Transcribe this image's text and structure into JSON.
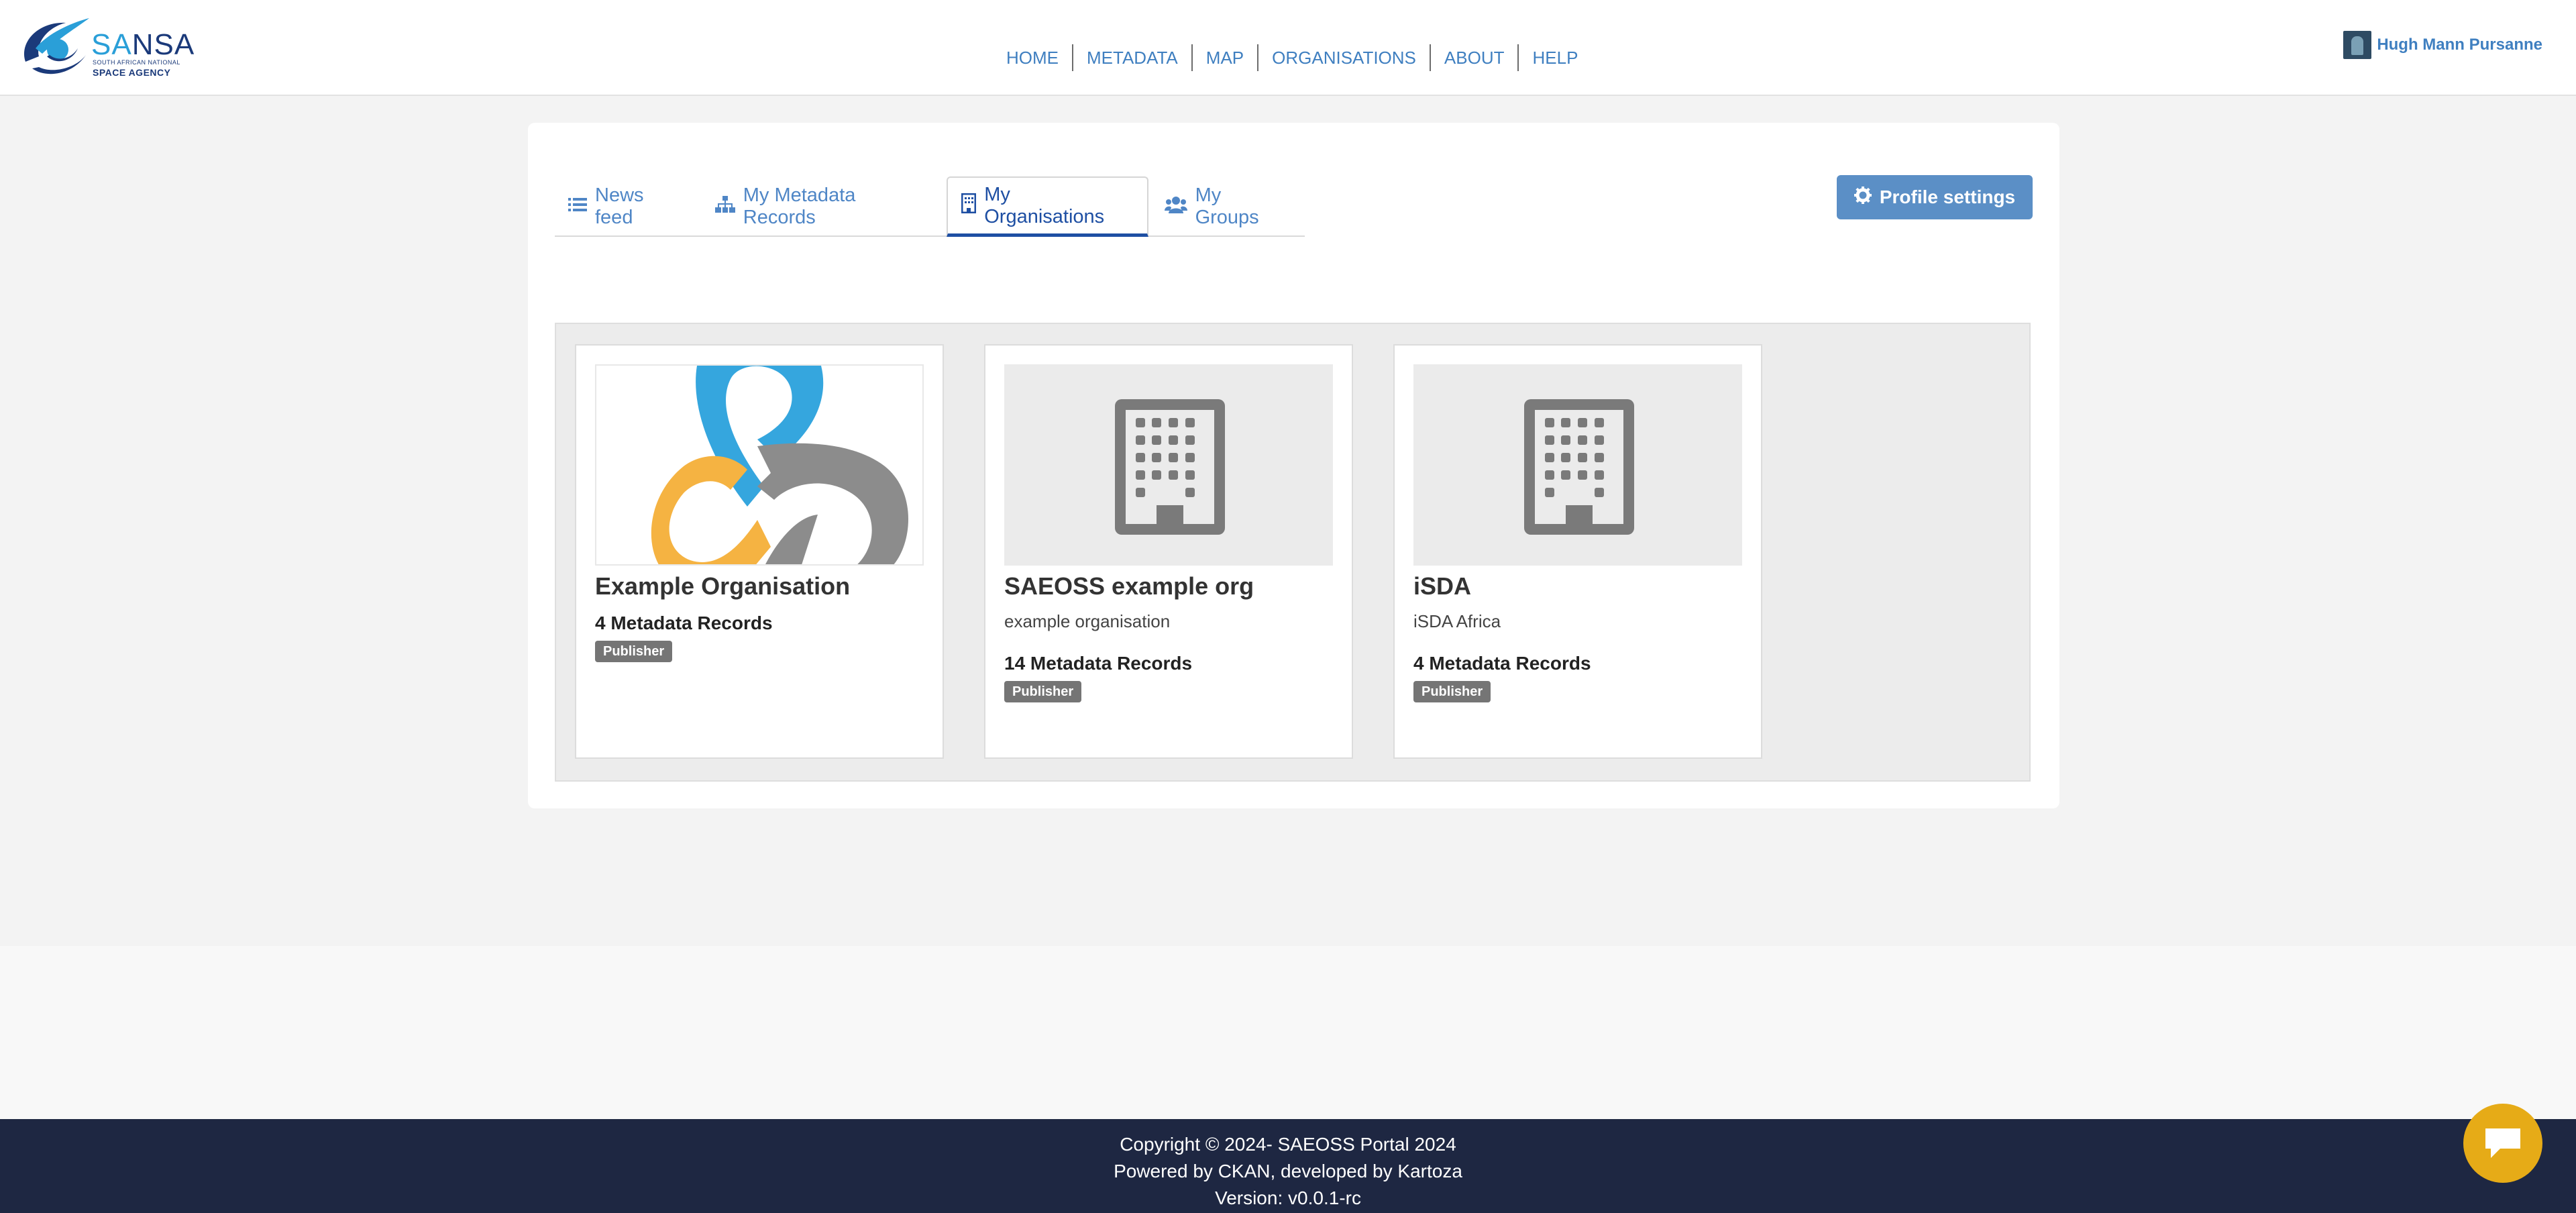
{
  "header": {
    "logo": {
      "name_prefix": "SA",
      "name_suffix": "NSA",
      "subline1": "SOUTH AFRICAN NATIONAL",
      "subline2": "SPACE AGENCY"
    },
    "nav": [
      "HOME",
      "METADATA",
      "MAP",
      "ORGANISATIONS",
      "ABOUT",
      "HELP"
    ],
    "user": {
      "name": "Hugh Mann Pursanne",
      "avatar_icon": "user-avatar"
    }
  },
  "tabs": [
    {
      "label": "News feed",
      "icon": "list-icon",
      "active": false
    },
    {
      "label": "My Metadata Records",
      "icon": "sitemap-icon",
      "active": false
    },
    {
      "label": "My Organisations",
      "icon": "building-icon",
      "active": true
    },
    {
      "label": "My Groups",
      "icon": "users-icon",
      "active": false
    }
  ],
  "profile_button": {
    "label": "Profile settings",
    "icon": "gear-icon"
  },
  "organisations": [
    {
      "title": "Example Organisation",
      "description": "",
      "count": "4 Metadata Records",
      "role": "Publisher",
      "image": "trefoil-logo"
    },
    {
      "title": "SAEOSS example org",
      "description": "example organisation",
      "count": "14 Metadata Records",
      "role": "Publisher",
      "image": "building-placeholder"
    },
    {
      "title": "iSDA",
      "description": "iSDA Africa",
      "count": "4 Metadata Records",
      "role": "Publisher",
      "image": "building-placeholder"
    }
  ],
  "footer": {
    "copyright": "Copyright © 2024- SAEOSS Portal 2024",
    "powered": "Powered by CKAN, developed by Kartoza",
    "version": "Version: v0.0.1-rc"
  },
  "chat": {
    "icon": "chat-icon"
  },
  "colors": {
    "nav_link": "#3f7fc0",
    "active_tab": "#1e4fa3",
    "footer_bg": "#1e2742",
    "chat_bg": "#e6ab17",
    "button_bg": "#5b8fc6"
  }
}
